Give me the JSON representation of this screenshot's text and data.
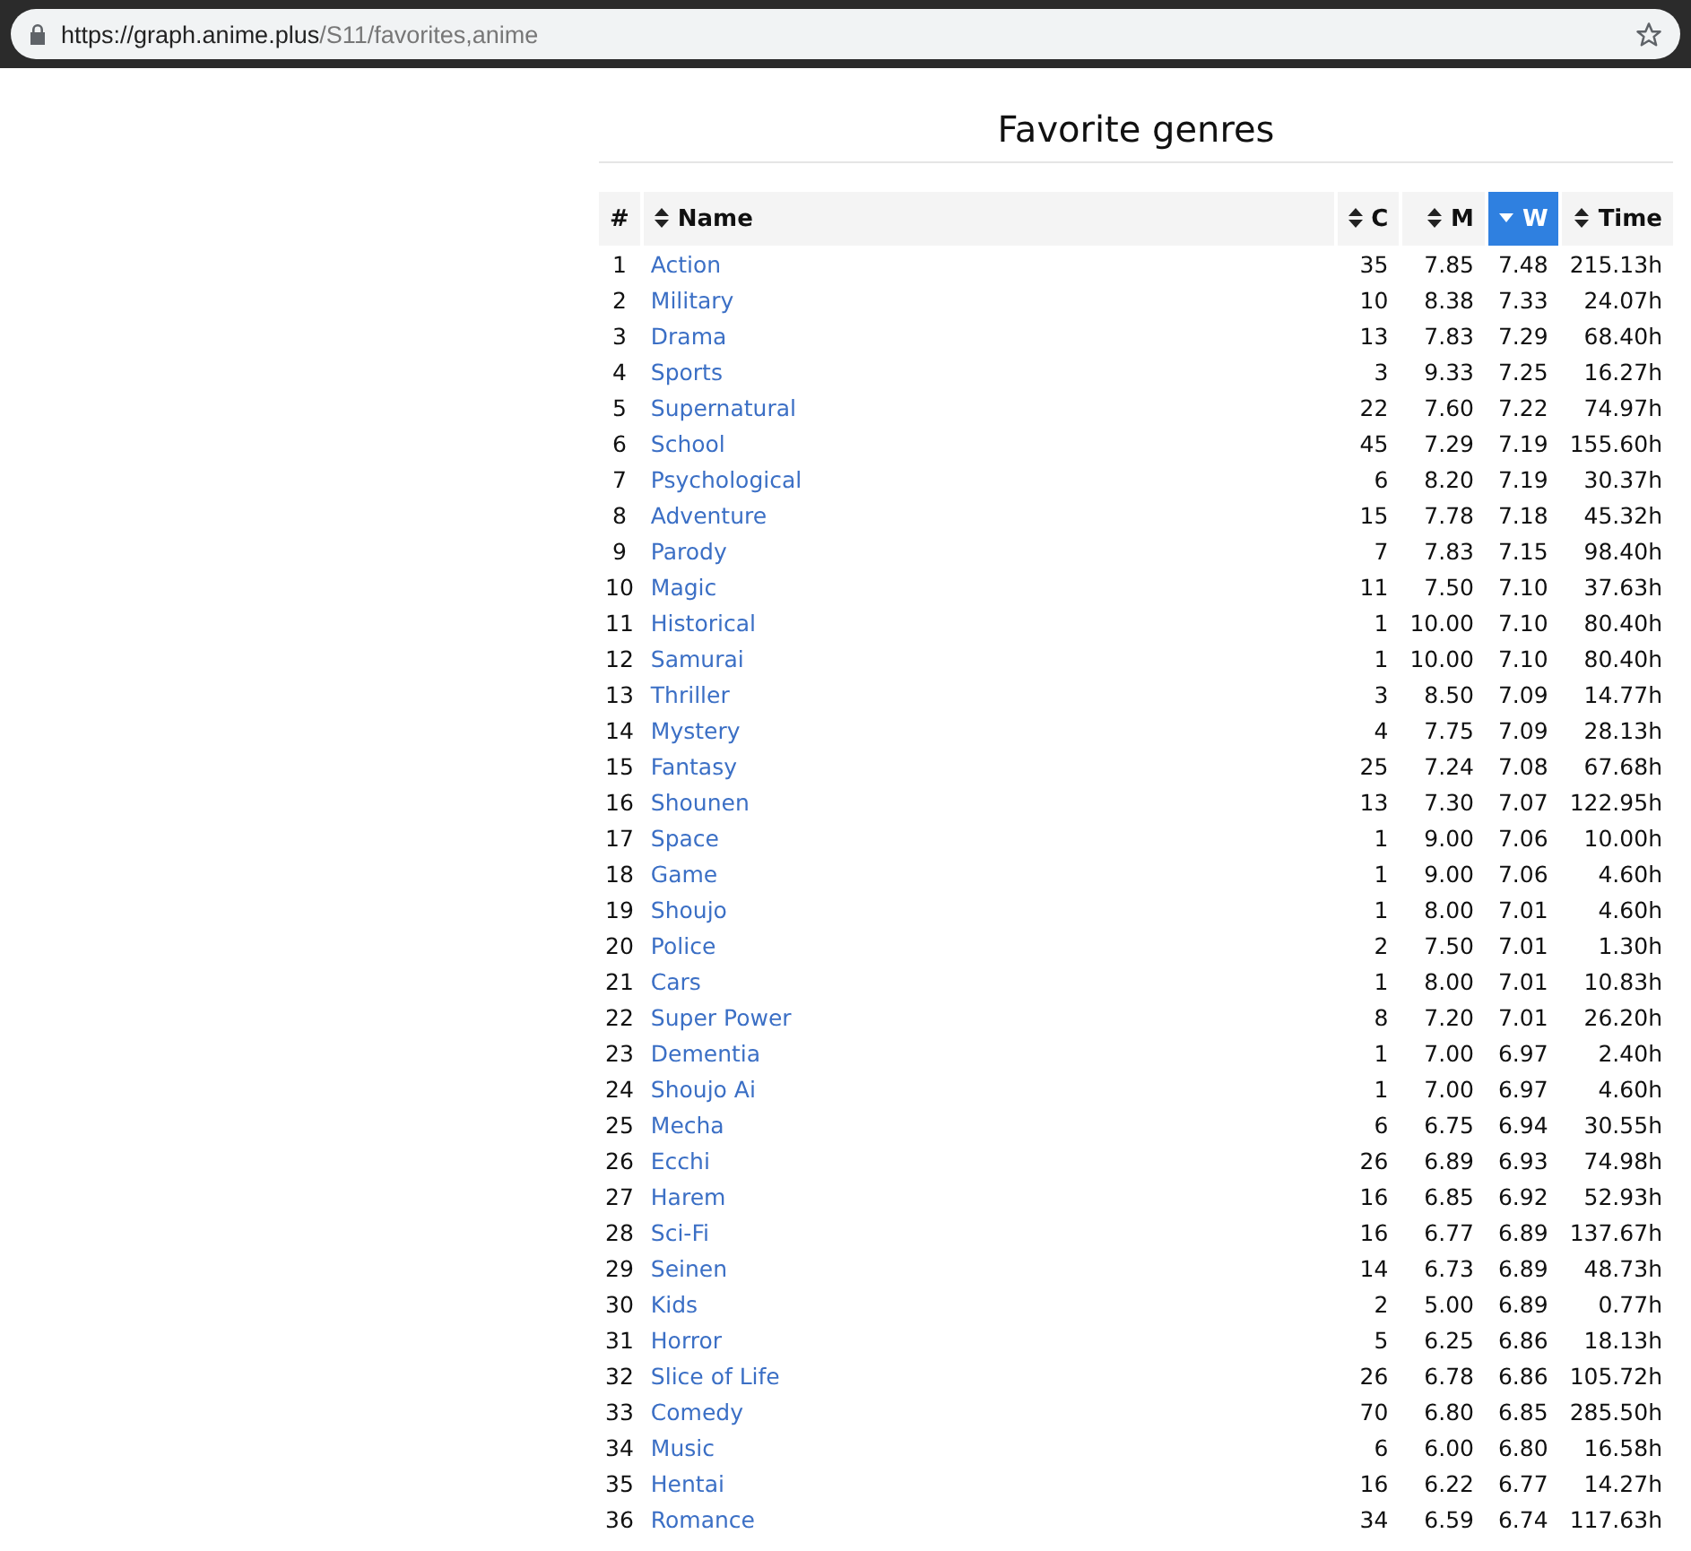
{
  "browser": {
    "url_host": "https://graph.anime.plus",
    "url_path": "/S11/favorites,anime"
  },
  "title": "Favorite genres",
  "table": {
    "columns": [
      {
        "label": "#",
        "sortable": false,
        "selected": false
      },
      {
        "label": "Name",
        "sortable": true,
        "selected": false
      },
      {
        "label": "C",
        "sortable": true,
        "selected": false
      },
      {
        "label": "M",
        "sortable": true,
        "selected": false
      },
      {
        "label": "W",
        "sortable": true,
        "selected": true
      },
      {
        "label": "Time",
        "sortable": true,
        "selected": false
      }
    ],
    "rows": [
      [
        "1",
        "Action",
        "35",
        "7.85",
        "7.48",
        "215.13h"
      ],
      [
        "2",
        "Military",
        "10",
        "8.38",
        "7.33",
        "24.07h"
      ],
      [
        "3",
        "Drama",
        "13",
        "7.83",
        "7.29",
        "68.40h"
      ],
      [
        "4",
        "Sports",
        "3",
        "9.33",
        "7.25",
        "16.27h"
      ],
      [
        "5",
        "Supernatural",
        "22",
        "7.60",
        "7.22",
        "74.97h"
      ],
      [
        "6",
        "School",
        "45",
        "7.29",
        "7.19",
        "155.60h"
      ],
      [
        "7",
        "Psychological",
        "6",
        "8.20",
        "7.19",
        "30.37h"
      ],
      [
        "8",
        "Adventure",
        "15",
        "7.78",
        "7.18",
        "45.32h"
      ],
      [
        "9",
        "Parody",
        "7",
        "7.83",
        "7.15",
        "98.40h"
      ],
      [
        "10",
        "Magic",
        "11",
        "7.50",
        "7.10",
        "37.63h"
      ],
      [
        "11",
        "Historical",
        "1",
        "10.00",
        "7.10",
        "80.40h"
      ],
      [
        "12",
        "Samurai",
        "1",
        "10.00",
        "7.10",
        "80.40h"
      ],
      [
        "13",
        "Thriller",
        "3",
        "8.50",
        "7.09",
        "14.77h"
      ],
      [
        "14",
        "Mystery",
        "4",
        "7.75",
        "7.09",
        "28.13h"
      ],
      [
        "15",
        "Fantasy",
        "25",
        "7.24",
        "7.08",
        "67.68h"
      ],
      [
        "16",
        "Shounen",
        "13",
        "7.30",
        "7.07",
        "122.95h"
      ],
      [
        "17",
        "Space",
        "1",
        "9.00",
        "7.06",
        "10.00h"
      ],
      [
        "18",
        "Game",
        "1",
        "9.00",
        "7.06",
        "4.60h"
      ],
      [
        "19",
        "Shoujo",
        "1",
        "8.00",
        "7.01",
        "4.60h"
      ],
      [
        "20",
        "Police",
        "2",
        "7.50",
        "7.01",
        "1.30h"
      ],
      [
        "21",
        "Cars",
        "1",
        "8.00",
        "7.01",
        "10.83h"
      ],
      [
        "22",
        "Super Power",
        "8",
        "7.20",
        "7.01",
        "26.20h"
      ],
      [
        "23",
        "Dementia",
        "1",
        "7.00",
        "6.97",
        "2.40h"
      ],
      [
        "24",
        "Shoujo Ai",
        "1",
        "7.00",
        "6.97",
        "4.60h"
      ],
      [
        "25",
        "Mecha",
        "6",
        "6.75",
        "6.94",
        "30.55h"
      ],
      [
        "26",
        "Ecchi",
        "26",
        "6.89",
        "6.93",
        "74.98h"
      ],
      [
        "27",
        "Harem",
        "16",
        "6.85",
        "6.92",
        "52.93h"
      ],
      [
        "28",
        "Sci-Fi",
        "16",
        "6.77",
        "6.89",
        "137.67h"
      ],
      [
        "29",
        "Seinen",
        "14",
        "6.73",
        "6.89",
        "48.73h"
      ],
      [
        "30",
        "Kids",
        "2",
        "5.00",
        "6.89",
        "0.77h"
      ],
      [
        "31",
        "Horror",
        "5",
        "6.25",
        "6.86",
        "18.13h"
      ],
      [
        "32",
        "Slice of Life",
        "26",
        "6.78",
        "6.86",
        "105.72h"
      ],
      [
        "33",
        "Comedy",
        "70",
        "6.80",
        "6.85",
        "285.50h"
      ],
      [
        "34",
        "Music",
        "6",
        "6.00",
        "6.80",
        "16.58h"
      ],
      [
        "35",
        "Hentai",
        "16",
        "6.22",
        "6.77",
        "14.27h"
      ],
      [
        "36",
        "Romance",
        "34",
        "6.59",
        "6.74",
        "117.63h"
      ]
    ]
  }
}
